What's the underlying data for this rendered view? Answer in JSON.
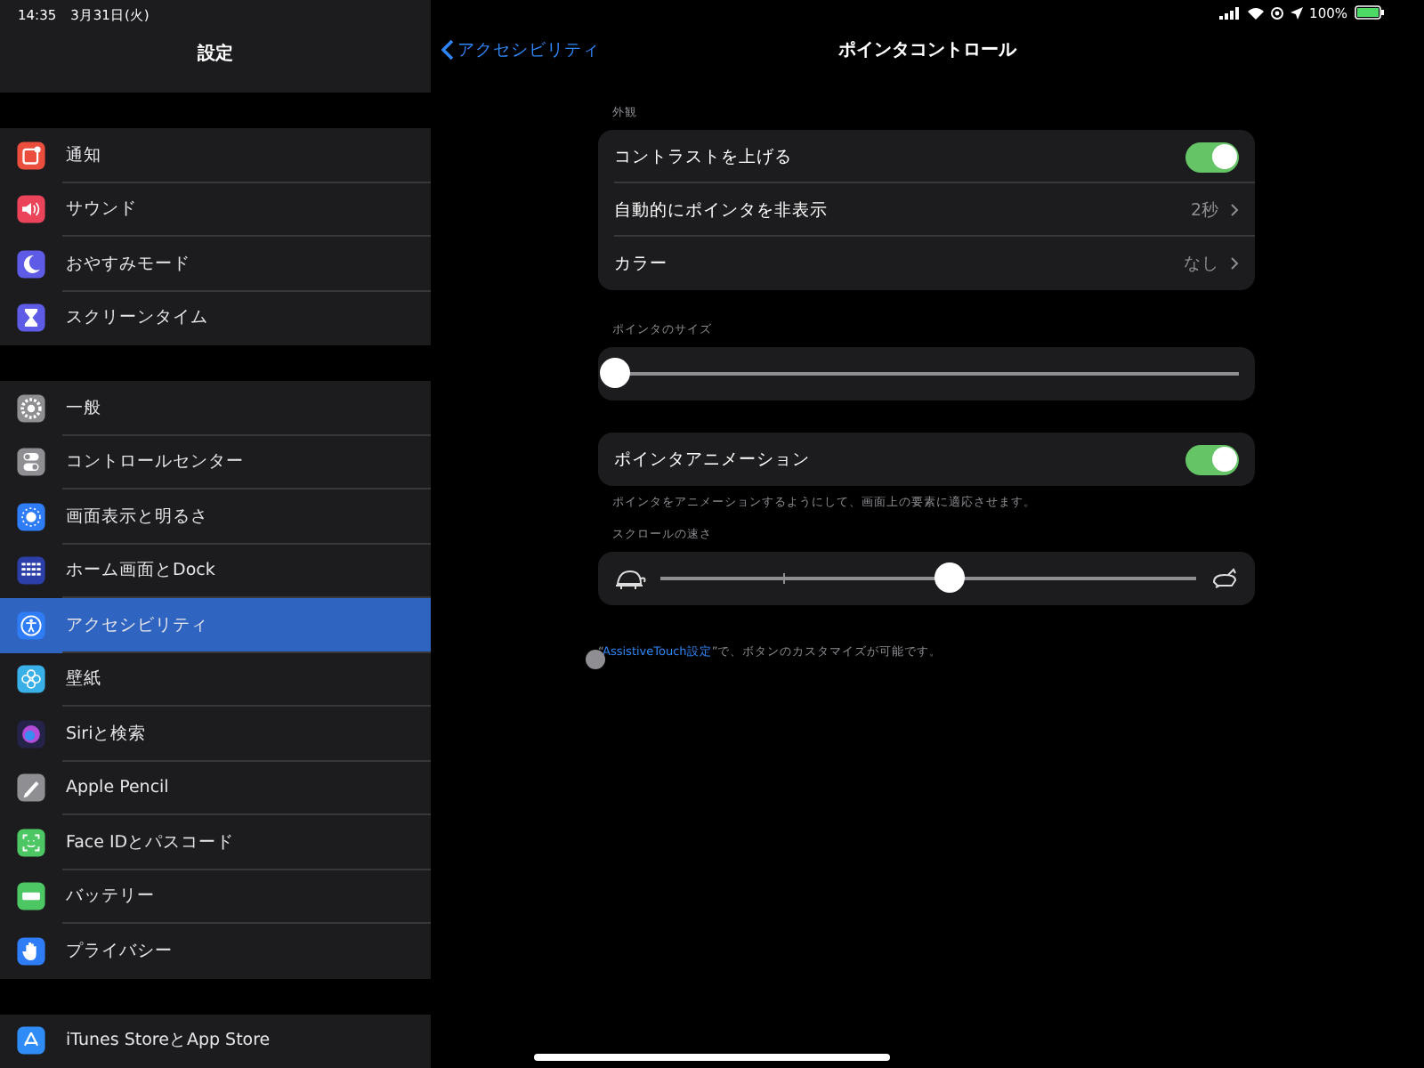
{
  "status_bar": {
    "time": "14:35",
    "date": "3月31日(火)",
    "battery": "100%"
  },
  "sidebar": {
    "title": "設定",
    "groups": [
      [
        {
          "label": "通知",
          "kind": "notification",
          "color": "#eb4e3d",
          "selected": false
        },
        {
          "label": "サウンド",
          "kind": "speaker",
          "color": "#eb445a",
          "selected": false
        },
        {
          "label": "おやすみモード",
          "kind": "moon",
          "color": "#5e5ce6",
          "selected": false
        },
        {
          "label": "スクリーンタイム",
          "kind": "hourglass",
          "color": "#5e5ce6",
          "selected": false
        }
      ],
      [
        {
          "label": "一般",
          "kind": "gear",
          "color": "#8e8e93",
          "selected": false
        },
        {
          "label": "コントロールセンター",
          "kind": "switches",
          "color": "#8e8e93",
          "selected": false
        },
        {
          "label": "画面表示と明るさ",
          "kind": "brightness",
          "color": "#2f7df6",
          "selected": false
        },
        {
          "label": "ホーム画面とDock",
          "kind": "grid",
          "color": "#2c3ea8",
          "selected": false
        },
        {
          "label": "アクセシビリティ",
          "kind": "person",
          "color": "#2f7df6",
          "selected": true
        },
        {
          "label": "壁紙",
          "kind": "flower",
          "color": "#3ab0e8",
          "selected": false
        },
        {
          "label": "Siriと検索",
          "kind": "orb",
          "color": "#26234a",
          "selected": false
        },
        {
          "label": "Apple Pencil",
          "kind": "pencil",
          "color": "#8e8e93",
          "selected": false
        },
        {
          "label": "Face IDとパスコード",
          "kind": "face",
          "color": "#4cc763",
          "selected": false
        },
        {
          "label": "バッテリー",
          "kind": "battery",
          "color": "#4cc763",
          "selected": false
        },
        {
          "label": "プライバシー",
          "kind": "hand",
          "color": "#2f7df6",
          "selected": false
        }
      ],
      [
        {
          "label": "iTunes StoreとApp Store",
          "kind": "triangle",
          "color": "#2f8cf6",
          "selected": false
        }
      ]
    ]
  },
  "nav": {
    "back": "アクセシビリティ",
    "title": "ポインタコントロール"
  },
  "sections": [
    {
      "kind": "list",
      "label": "外観",
      "rows": [
        {
          "kind": "toggle",
          "label": "コントラストを上げる",
          "on": true
        },
        {
          "kind": "link",
          "label": "自動的にポインタを非表示",
          "value": "2秒"
        },
        {
          "kind": "link",
          "label": "カラー",
          "value": "なし"
        }
      ]
    },
    {
      "kind": "slider",
      "label": "ポインタのサイズ",
      "level": 0
    },
    {
      "kind": "list",
      "rows": [
        {
          "kind": "toggle",
          "label": "ポインタアニメーション",
          "on": true
        }
      ],
      "footer": "ポインタをアニメーションするようにして、画面上の要素に適応させます。"
    },
    {
      "kind": "speed_slider",
      "label": "スクロールの速さ",
      "level": 0.54
    }
  ],
  "note": {
    "prefix": "“",
    "link": "AssistiveTouch設定",
    "suffix": "”で、ボタンのカスタマイズが可能です。"
  }
}
